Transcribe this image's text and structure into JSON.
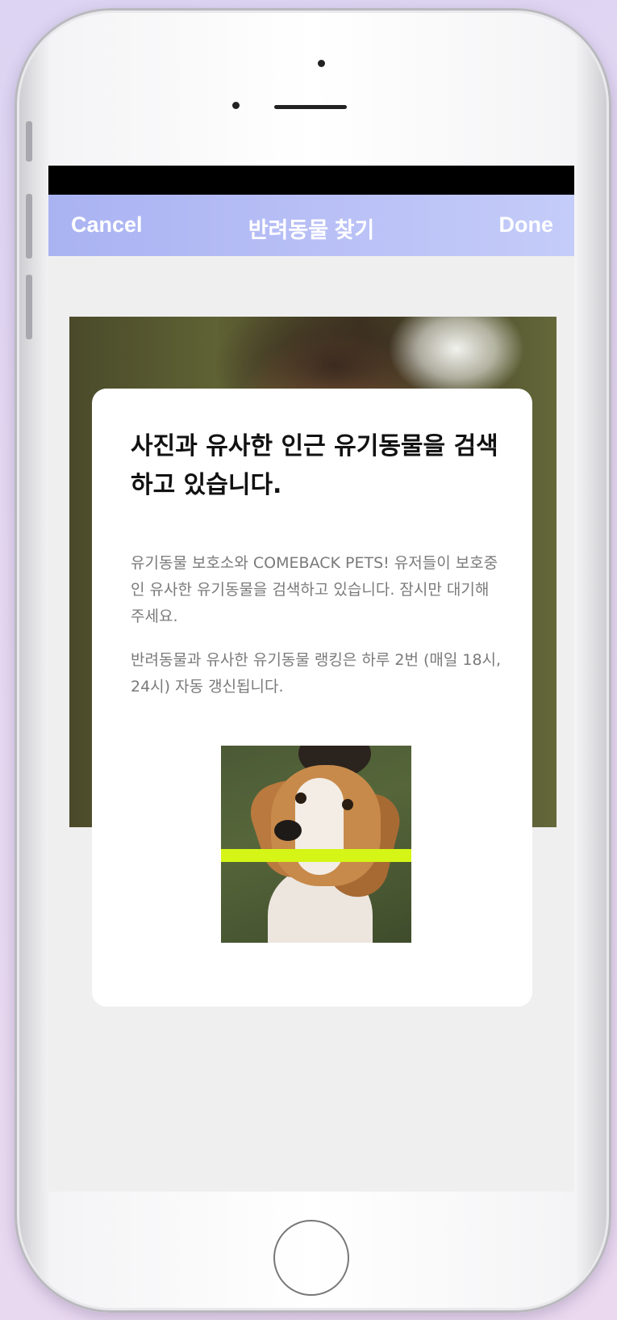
{
  "nav": {
    "cancel_label": "Cancel",
    "title": "반려동물 찾기",
    "done_label": "Done"
  },
  "modal": {
    "title": "사진과 유사한 인근 유기동물을 검색하고 있습니다.",
    "paragraph1": "유기동물 보호소와 COMEBACK PETS! 유저들이 보호중인 유사한 유기동물을 검색하고 있습니다. 잠시만 대기해주세요.",
    "paragraph2": "반려동물과 유사한 유기동물 랭킹은 하루 2번 (매일 18시, 24시) 자동 갱신됩니다."
  },
  "colors": {
    "nav_gradient_start": "#aab3f2",
    "nav_gradient_end": "#c4ccf9",
    "scan_line": "#d4f516",
    "page_background": "#e6d8f1"
  },
  "icons": {
    "home_button": "home-button",
    "scan_line": "scan-line"
  }
}
